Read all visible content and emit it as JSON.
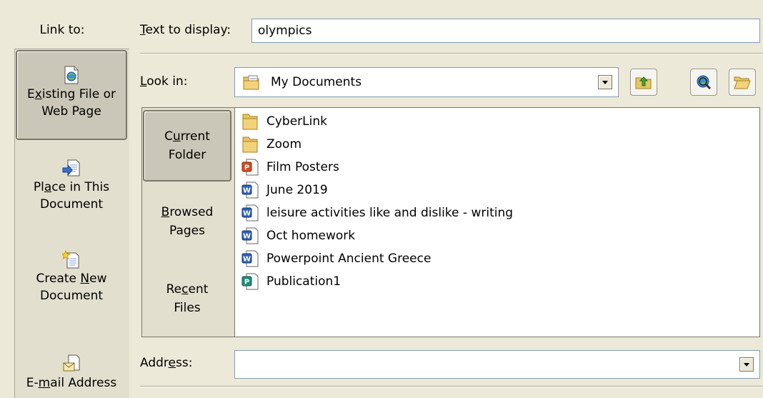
{
  "link_to": {
    "label": "Link to:",
    "items": [
      {
        "pre": "E",
        "key": "x",
        "post": "isting File or",
        "line2": "Web Page",
        "icon": "existing-file-icon",
        "selected": true
      },
      {
        "pre": "Pl",
        "key": "a",
        "post": "ce in This",
        "line2": "Document",
        "icon": "place-in-document-icon"
      },
      {
        "pre": "Create ",
        "key": "N",
        "post": "ew",
        "line2": "Document",
        "icon": "create-new-document-icon"
      },
      {
        "pre": "E-",
        "key": "m",
        "post": "ail Address",
        "line2": "",
        "icon": "email-address-icon"
      }
    ]
  },
  "text_to_display": {
    "label_key": "T",
    "label_rest": "ext to display:",
    "value": "olympics"
  },
  "look_in": {
    "label_key": "L",
    "label_rest": "ook in:",
    "value": "My Documents",
    "icon": "my-documents-folder-icon",
    "tools": [
      "up-one-folder-icon",
      "browse-web-icon",
      "browse-file-icon"
    ]
  },
  "nav": {
    "current_folder": {
      "pre": "C",
      "key": "u",
      "post": "rrent",
      "line2": "Folder"
    },
    "browsed_pages": {
      "pre": "",
      "key": "B",
      "post": "rowsed",
      "line2": "Pages"
    },
    "recent_files": {
      "pre": "Re",
      "key": "c",
      "post": "ent",
      "line2": "Files"
    }
  },
  "files": [
    {
      "name": "CyberLink",
      "type": "folder"
    },
    {
      "name": "Zoom",
      "type": "folder"
    },
    {
      "name": "Film Posters",
      "type": "powerpoint"
    },
    {
      "name": "June 2019",
      "type": "word"
    },
    {
      "name": "leisure activities like and dislike - writing",
      "type": "word"
    },
    {
      "name": "Oct homework",
      "type": "word"
    },
    {
      "name": "Powerpoint Ancient Greece",
      "type": "word"
    },
    {
      "name": "Publication1",
      "type": "publisher"
    }
  ],
  "address": {
    "label_pre": "Addr",
    "label_key": "e",
    "label_post": "ss:",
    "value": ""
  }
}
